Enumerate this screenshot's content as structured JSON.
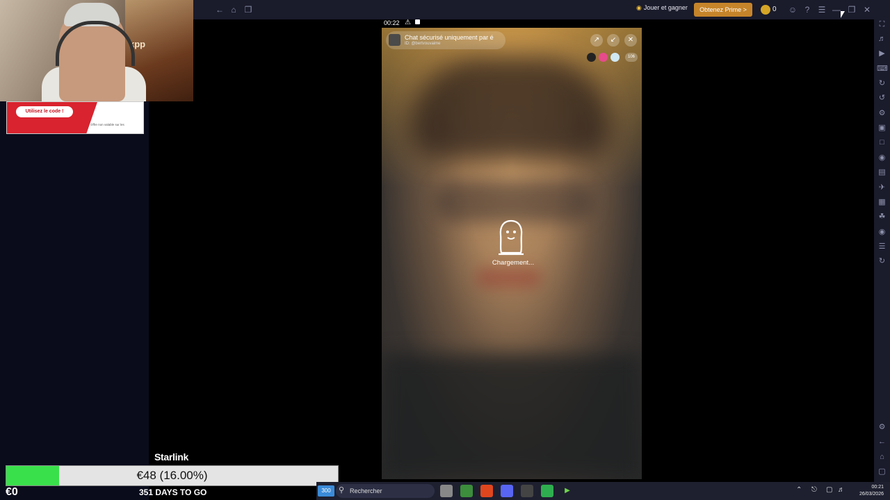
{
  "emulator": {
    "play_and_earn": "Jouer et gagner",
    "prime_button": "Obtenez Prime >",
    "coin_count": "0",
    "nav_icons": [
      "back-arrow-icon",
      "home-icon",
      "multitask-icon"
    ],
    "window_icons": [
      "account-icon",
      "help-icon",
      "menu-icon",
      "minimize-icon",
      "restore-icon",
      "close-icon",
      "collapse-icon"
    ],
    "sidebar_icons": [
      "fullscreen-icon",
      "volume-icon",
      "media-icon",
      "keyboard-icon",
      "rotate-icon",
      "sync-icon",
      "macro-icon",
      "apk-icon",
      "screenshot-icon",
      "record-icon",
      "folder-icon",
      "airplane-icon",
      "multi-instance-icon",
      "eco-icon",
      "location-icon",
      "layers-icon",
      "restart-icon",
      "settings-icon",
      "back-icon",
      "android-home-icon",
      "recents-icon"
    ]
  },
  "phone": {
    "status_time": "00:22",
    "chat_title": "Chat sécurisé uniquement par é",
    "chat_subtitle": "ID: @bertvouvaime",
    "viewer_count": "106",
    "loading_text": "Chargement..."
  },
  "promo": {
    "button_label": "Utilisez le code !",
    "fine_print": "Offre non valable sur les"
  },
  "webcam": {
    "art_text": "kpp"
  },
  "goal": {
    "title": "Starlink",
    "amount_label": "€48 (16.00%)",
    "progress": 0.16,
    "start_label": "€0",
    "days_label": "351 DAYS TO GO"
  },
  "taskbar": {
    "widget_label": "300",
    "search_label": "Rechercher",
    "clock_time": "00:21",
    "clock_date": "26/03/2026"
  },
  "colors": {
    "goal_fill": "#3ae04c",
    "prime_bg": "#c6842a",
    "topbar_bg": "#1a1b2b"
  }
}
